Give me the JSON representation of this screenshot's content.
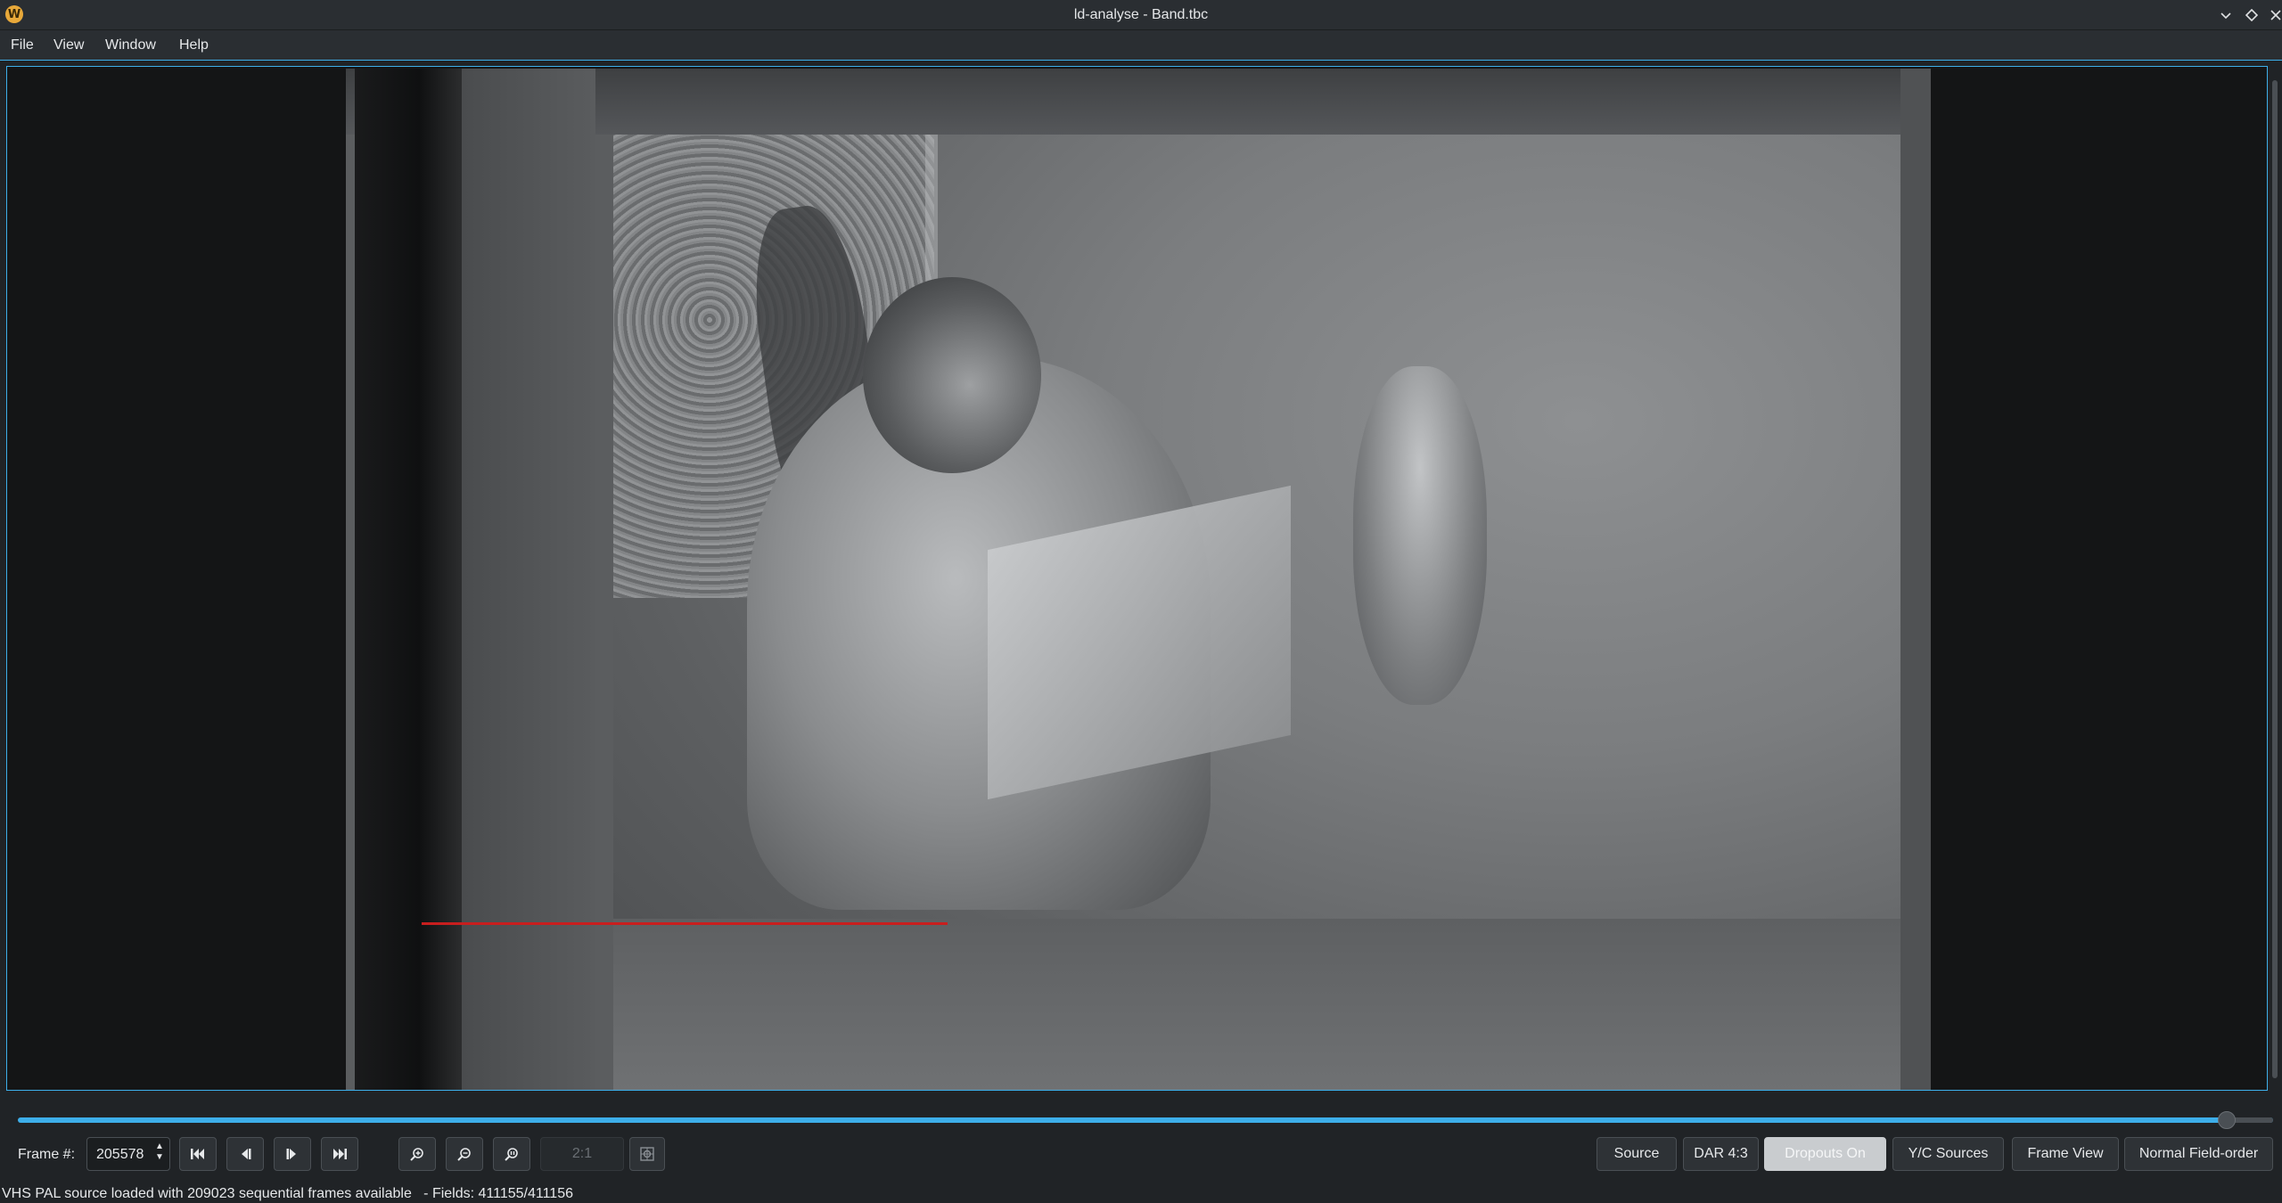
{
  "window": {
    "title": "ld-analyse - Band.tbc",
    "app_icon": "W",
    "controls": [
      "minimize-icon",
      "maximize-icon",
      "close-icon"
    ]
  },
  "menu": {
    "items": [
      "File",
      "View",
      "Window",
      "Help"
    ]
  },
  "player": {
    "frame_label": "Frame #:",
    "frame_number": "205578",
    "frame_total": 209023,
    "buttons": [
      "first-frame-icon",
      "previous-frame-icon",
      "next-frame-icon",
      "last-frame-icon"
    ],
    "zoom_buttons": [
      "zoom-in-icon",
      "zoom-out-icon",
      "zoom-original-icon"
    ],
    "zoom_ratio": "2:1",
    "mouse_mode_icon": "crosshair-icon"
  },
  "view_buttons": {
    "source": "Source",
    "dar": "DAR 4:3",
    "dropouts": "Dropouts On",
    "yc_sources": "Y/C Sources",
    "frame_view": "Frame View",
    "field_order": "Normal Field-order"
  },
  "colors": {
    "accent": "#3daee9",
    "dropout_marker": "#c81e1e",
    "background": "#202326"
  },
  "status": {
    "text": "VHS PAL source loaded with 209023 sequential frames available   - Fields: 411155/411156"
  }
}
